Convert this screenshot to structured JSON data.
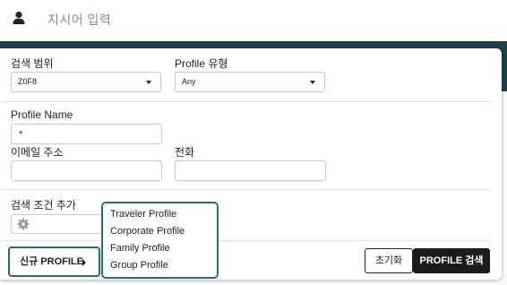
{
  "header": {
    "instruction": "지시어 입력",
    "icon": "user-icon"
  },
  "search_panel": {
    "scope": {
      "label": "검색 범위",
      "value": "Z0F8"
    },
    "profile_type": {
      "label": "Profile 유형",
      "value": "Any"
    },
    "profile_name": {
      "label": "Profile Name",
      "value": "*"
    },
    "email": {
      "label": "이메일 주소",
      "value": ""
    },
    "phone": {
      "label": "전화",
      "value": ""
    },
    "add_condition": {
      "label": "검색 조건 추가",
      "icon": "gear-icon"
    }
  },
  "actions": {
    "new_profile": "신규 PROFILE",
    "reset": "초기화",
    "search": "PROFILE 검색"
  },
  "new_profile_menu": {
    "items": [
      "Traveler Profile",
      "Corporate Profile",
      "Family Profile",
      "Group Profile"
    ]
  },
  "colors": {
    "accent": "#2b6f78",
    "band": "#1f3f4a",
    "primary_button": "#1c1c1c"
  }
}
